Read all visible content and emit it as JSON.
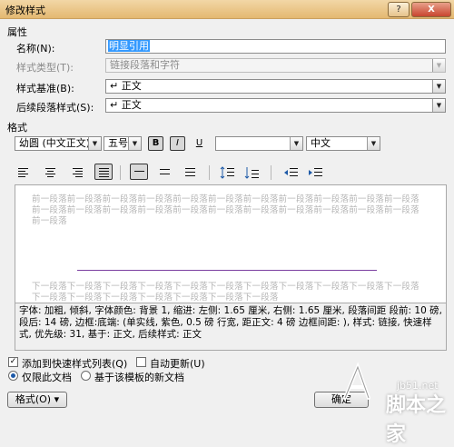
{
  "window": {
    "title": "修改样式",
    "help": "?",
    "close": "X"
  },
  "properties": {
    "section": "属性",
    "name_label": "名称(N):",
    "name_value": "明显引用",
    "type_label": "样式类型(T):",
    "type_value": "链接段落和字符",
    "based_label": "样式基准(B):",
    "based_value": "↵ 正文",
    "next_label": "后续段落样式(S):",
    "next_value": "↵ 正文"
  },
  "format": {
    "section": "格式",
    "font": "幼圆  (中文正文)",
    "size": "五号",
    "bold": "B",
    "italic": "I",
    "underline": "U",
    "color": "",
    "script": "中文"
  },
  "preview": {
    "before_text": "前一段落前一段落前一段落前一段落前一段落前一段落前一段落前一段落前一段落前一段落前一段落前一段落前一段落前一段落前一段落前一段落前一段落前一段落前一段落前一段落前一段落前一段落前一段落",
    "after_text": "下一段落下一段落下一段落下一段落下一段落下一段落下一段落下一段落下一段落下一段落下一段落下一段落下一段落下一段落下一段落下一段落下一段落下一段落"
  },
  "description": "字体: 加粗, 倾斜, 字体颜色: 背景 1, 缩进: 左侧:  1.65 厘米, 右侧:  1.65 厘米, 段落间距 段前: 10 磅, 段后: 14 磅, 边框:底端: (单实线, 紫色,  0.5 磅 行宽, 距正文:  4 磅 边框间距: ), 样式: 链接, 快速样式, 优先级: 31, 基于: 正文, 后续样式: 正文",
  "options": {
    "add_quick": "添加到快速样式列表(Q)",
    "auto_update": "自动更新(U)",
    "only_doc": "仅限此文档",
    "new_docs": "基于该模板的新文档"
  },
  "buttons": {
    "format": "格式(O) ▾",
    "ok": "确定"
  },
  "watermark": {
    "site": "jb51.net",
    "brand": "脚本之家"
  },
  "colors": {
    "accent": "#3399ff",
    "border_line": "#7b3fa0"
  }
}
